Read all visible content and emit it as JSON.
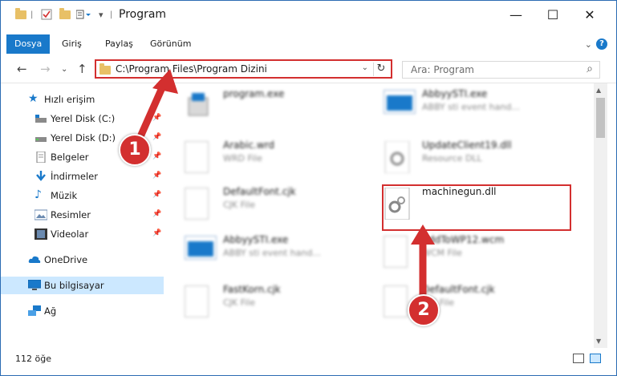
{
  "window": {
    "title": "Program",
    "controls": {
      "minimize": "—",
      "maximize": "☐",
      "close": "✕"
    }
  },
  "ribbon": {
    "tabs": [
      "Dosya",
      "Giriş",
      "Paylaş",
      "Görünüm"
    ],
    "active_tab": "Dosya",
    "collapse_icon": "chevron-down-icon",
    "help_label": "?"
  },
  "navigation": {
    "address": "C:\\Program Files\\Program Dizini",
    "search_placeholder": "Ara: Program"
  },
  "sidebar": {
    "quick_access": "Hızlı erişim",
    "items": [
      {
        "label": "Yerel Disk (C:)",
        "icon": "drive-icon",
        "pinned": true
      },
      {
        "label": "Yerel Disk (D:)",
        "icon": "drive-icon",
        "pinned": true
      },
      {
        "label": "Belgeler",
        "icon": "documents-icon",
        "pinned": true
      },
      {
        "label": "İndirmeler",
        "icon": "download-icon",
        "pinned": true
      },
      {
        "label": "Müzik",
        "icon": "music-icon",
        "pinned": true
      },
      {
        "label": "Resimler",
        "icon": "pictures-icon",
        "pinned": true
      },
      {
        "label": "Videolar",
        "icon": "video-icon",
        "pinned": true
      }
    ],
    "onedrive": "OneDrive",
    "this_pc": "Bu bilgisayar",
    "network": "Ağ"
  },
  "files": [
    {
      "name": "program.exe",
      "type": "",
      "icon": "installer-icon"
    },
    {
      "name": "AbbyySTI.exe",
      "type": "ABBY sti event hand...",
      "icon": "exe-icon"
    },
    {
      "name": "Arabic.wrd",
      "type": "WRD File",
      "icon": "file-icon"
    },
    {
      "name": "UpdateClient19.dll",
      "type": "Resource DLL",
      "icon": "dll-icon"
    },
    {
      "name": "DefaultFont.cjk",
      "type": "CJK File",
      "icon": "file-icon"
    },
    {
      "name": "machinegun.dll",
      "type": "",
      "icon": "dll-icon"
    },
    {
      "name": "AbbyySTI.exe",
      "type": "ABBY sti event hand...",
      "icon": "exe-icon"
    },
    {
      "name": "AddToWP12.wcm",
      "type": "WCM File",
      "icon": "file-icon"
    },
    {
      "name": "FastKorn.cjk",
      "type": "CJK File",
      "icon": "file-icon"
    },
    {
      "name": "DefaultFont.cjk",
      "type": "CJK File",
      "icon": "file-icon"
    }
  ],
  "status": {
    "count": "112 öğe"
  },
  "annotations": {
    "step1": "1",
    "step2": "2"
  },
  "colors": {
    "accent": "#1979ca",
    "highlight": "#d32f2f",
    "selection": "#cce8ff"
  }
}
